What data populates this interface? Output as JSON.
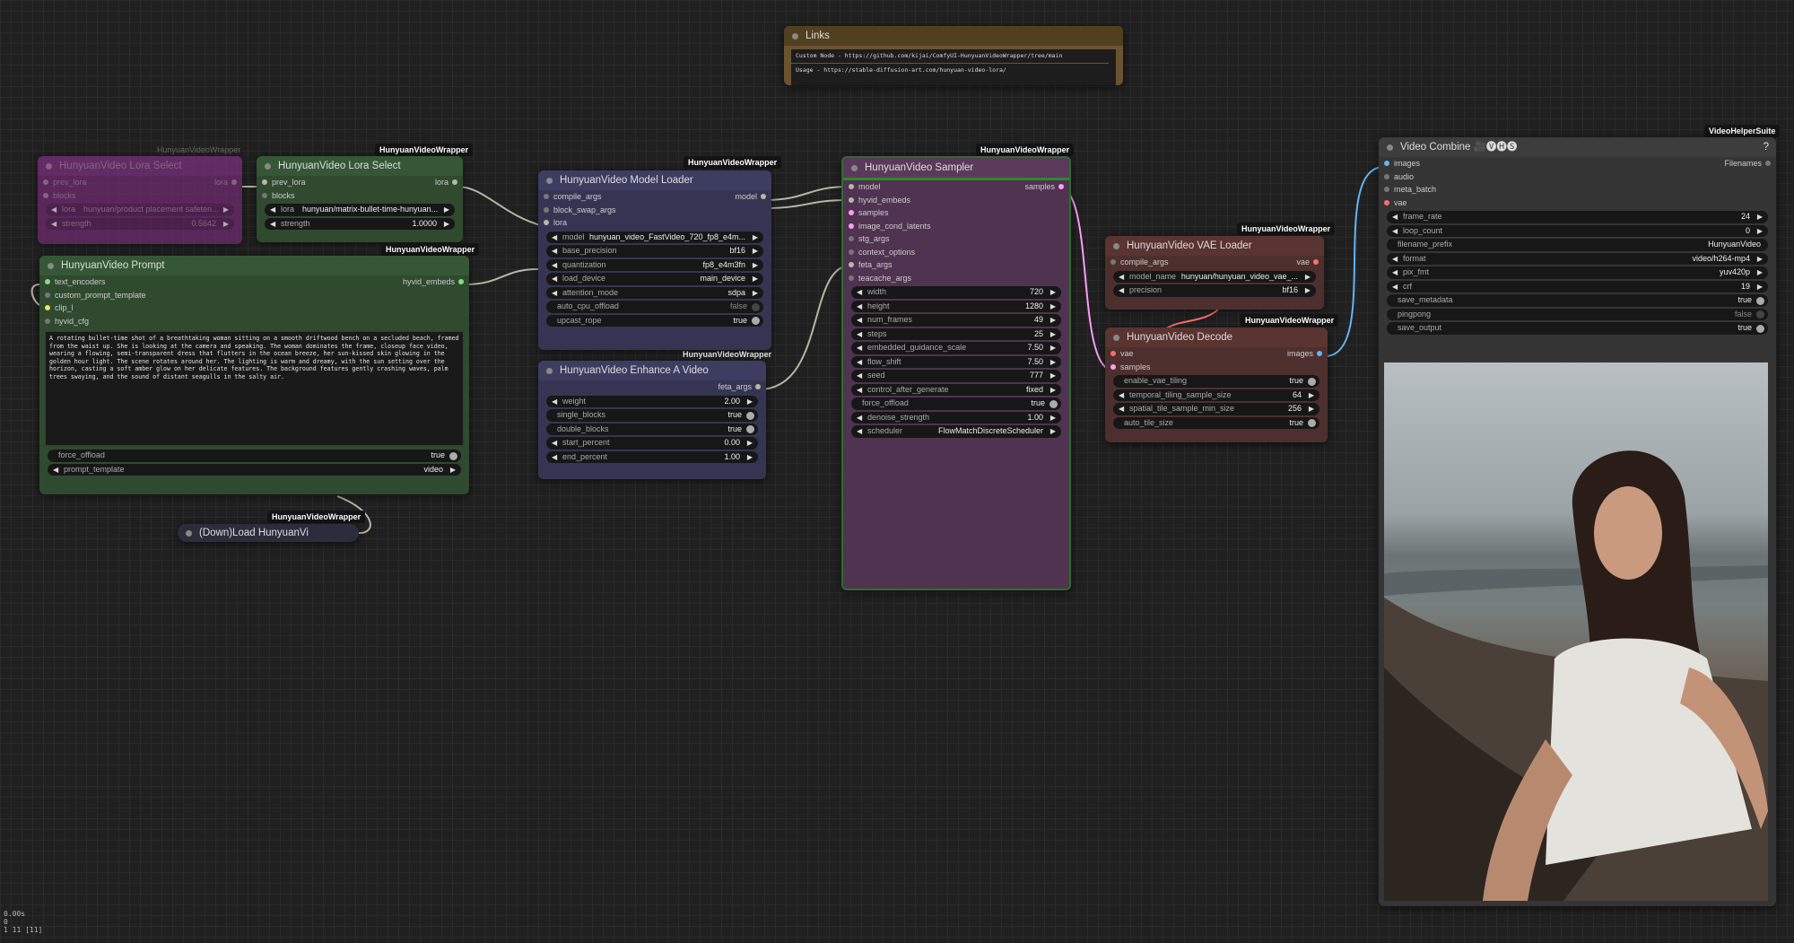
{
  "links_node": {
    "title": "Links",
    "line1": "Custom Node - https://github.com/kijai/ComfyUI-HunyuanVideoWrapper/tree/main",
    "line2": "Usage - https://stable-diffusion-art.com/hunyuan-video-lora/"
  },
  "lora_bypassed": {
    "badge": "HunyuanVideoWrapper",
    "title": "HunyuanVideo Lora Select",
    "in1": "prev_lora",
    "out1": "lora",
    "in2": "blocks",
    "lora_label": "lora",
    "lora_value": "hunyuan/product placement safeten...",
    "strength_label": "strength",
    "strength_value": "0.5642"
  },
  "lora_select": {
    "badge": "HunyuanVideoWrapper",
    "title": "HunyuanVideo Lora Select",
    "in1": "prev_lora",
    "out1": "lora",
    "in2": "blocks",
    "lora_label": "lora",
    "lora_value": "hunyuan/matrix-bullet-time-hunyuan...",
    "strength_label": "strength",
    "strength_value": "1.0000"
  },
  "prompt": {
    "badge": "HunyuanVideoWrapper",
    "title": "HunyuanVideo Prompt",
    "in1": "text_encoders",
    "out1": "hyvid_embeds",
    "in2": "custom_prompt_template",
    "in3": "clip_l",
    "in4": "hyvid_cfg",
    "text": "A rotating bullet-time shot of a breathtaking woman sitting on a smooth driftwood bench on a secluded beach, framed from the waist up. She is looking at the camera and speaking. The woman dominates the frame, closeup face video, wearing a flowing, semi-transparent dress that flutters in the ocean breeze, her sun-kissed skin glowing in the golden hour light. The scene rotates around her. The lighting is warm and dreamy, with the sun setting over the horizon, casting a soft amber glow on her delicate features. The background features gently crashing waves, palm trees swaying, and the sound of distant seagulls in the salty air.",
    "force_offload_label": "force_offload",
    "force_offload_value": "true",
    "prompt_template_label": "prompt_template",
    "prompt_template_value": "video"
  },
  "download": {
    "badge": "HunyuanVideoWrapper",
    "title": "(Down)Load HunyuanVi"
  },
  "model_loader": {
    "badge": "HunyuanVideoWrapper",
    "title": "HunyuanVideo Model Loader",
    "in1": "compile_args",
    "out1": "model",
    "in2": "block_swap_args",
    "in3": "lora",
    "widgets": [
      {
        "label": "model",
        "value": "hunyuan_video_FastVideo_720_fp8_e4m..."
      },
      {
        "label": "base_precision",
        "value": "bf16"
      },
      {
        "label": "quantization",
        "value": "fp8_e4m3fn"
      },
      {
        "label": "load_device",
        "value": "main_device"
      },
      {
        "label": "attention_mode",
        "value": "sdpa"
      }
    ],
    "bools": [
      {
        "label": "auto_cpu_offload",
        "value": "false"
      },
      {
        "label": "upcast_rope",
        "value": "true"
      }
    ]
  },
  "enhance": {
    "badge": "HunyuanVideoWrapper",
    "title": "HunyuanVideo Enhance A Video",
    "out1": "feta_args",
    "weight_label": "weight",
    "weight_value": "2.00",
    "single_label": "single_blocks",
    "single_value": "true",
    "double_label": "double_blocks",
    "double_value": "true",
    "start_label": "start_percent",
    "start_value": "0.00",
    "end_label": "end_percent",
    "end_value": "1.00"
  },
  "sampler": {
    "badge": "HunyuanVideoWrapper",
    "title": "HunyuanVideo Sampler",
    "out1": "samples",
    "inputs": [
      "model",
      "hyvid_embeds",
      "samples",
      "image_cond_latents",
      "stg_args",
      "context_options",
      "feta_args",
      "teacache_args"
    ],
    "widgets": [
      {
        "label": "width",
        "value": "720"
      },
      {
        "label": "height",
        "value": "1280"
      },
      {
        "label": "num_frames",
        "value": "49"
      },
      {
        "label": "steps",
        "value": "25"
      },
      {
        "label": "embedded_guidance_scale",
        "value": "7.50"
      },
      {
        "label": "flow_shift",
        "value": "7.50"
      },
      {
        "label": "seed",
        "value": "777"
      },
      {
        "label": "control_after_generate",
        "value": "fixed"
      }
    ],
    "force_offload_label": "force_offload",
    "force_offload_value": "true",
    "denoise_label": "denoise_strength",
    "denoise_value": "1.00",
    "scheduler_label": "scheduler",
    "scheduler_value": "FlowMatchDiscreteScheduler"
  },
  "vae_loader": {
    "badge": "HunyuanVideoWrapper",
    "title": "HunyuanVideo VAE Loader",
    "in1": "compile_args",
    "out1": "vae",
    "model_label": "model_name",
    "model_value": "hunyuan/hunyuan_video_vae_...",
    "precision_label": "precision",
    "precision_value": "bf16"
  },
  "decode": {
    "badge": "HunyuanVideoWrapper",
    "title": "HunyuanVideo Decode",
    "in1": "vae",
    "out1": "images",
    "in2": "samples",
    "bools": [
      {
        "label": "enable_vae_tiling",
        "value": "true"
      }
    ],
    "widgets": [
      {
        "label": "temporal_tiling_sample_size",
        "value": "64"
      },
      {
        "label": "spatial_tile_sample_min_size",
        "value": "256"
      }
    ],
    "auto_label": "auto_tile_size",
    "auto_value": "true"
  },
  "combine": {
    "badge": "VideoHelperSuite",
    "title": "Video Combine 🎥🅥🅗🅢",
    "help": "?",
    "in1": "images",
    "out1": "Filenames",
    "in2": "audio",
    "in3": "meta_batch",
    "in4": "vae",
    "frame_rate_label": "frame_rate",
    "frame_rate_value": "24",
    "loop_label": "loop_count",
    "loop_value": "0",
    "prefix_label": "filename_prefix",
    "prefix_value": "HunyuanVideo",
    "format_label": "format",
    "format_value": "video/h264-mp4",
    "pix_label": "pix_fmt",
    "pix_value": "yuv420p",
    "crf_label": "crf",
    "crf_value": "19",
    "save_meta_label": "save_metadata",
    "save_meta_value": "true",
    "pingpong_label": "pingpong",
    "pingpong_value": "false",
    "save_out_label": "save_output",
    "save_out_value": "true"
  },
  "status": {
    "line1": "0.00s",
    "line2": "0",
    "line3": "1 11 [11]"
  },
  "colors": {
    "canvas": "#202020",
    "green_node": "#2f4a2f",
    "blue_node": "#353553",
    "purple_node": "#4f3350",
    "brown_node": "#4d302d",
    "gray_node": "#353535",
    "link_model": "#b7b7a4",
    "link_latent": "#ff9cf9",
    "link_image": "#64b5f6",
    "link_vae": "#ff6e6e"
  }
}
